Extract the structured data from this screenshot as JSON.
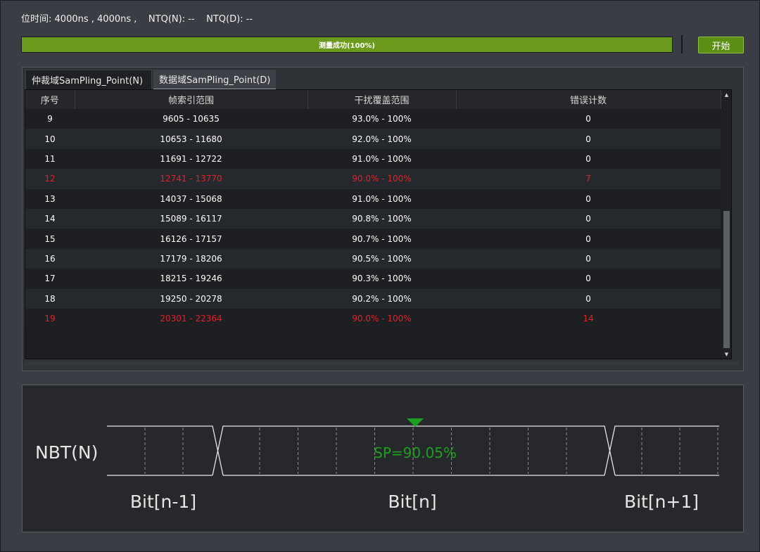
{
  "status": {
    "bit_time_label": "位时间:",
    "bit_time_value": "4000ns , 4000ns ,",
    "ntq_n": "NTQ(N): --",
    "ntq_d": "NTQ(D): --"
  },
  "progress": {
    "label": "测量成功(100%)",
    "value": 100,
    "color": "#6b9a1d"
  },
  "toolbar": {
    "start_label": "开始"
  },
  "tabs": [
    {
      "label": "仲裁域SamPling_Point(N)",
      "active": true
    },
    {
      "label": "数据域SamPling_Point(D)",
      "active": false
    }
  ],
  "table": {
    "columns": [
      "序号",
      "帧索引范围",
      "干扰覆盖范围",
      "错误计数"
    ],
    "rows": [
      {
        "index": "9",
        "frame_range": "9605 - 10635",
        "coverage": "93.0% - 100%",
        "errors": "0",
        "error": false
      },
      {
        "index": "10",
        "frame_range": "10653 - 11680",
        "coverage": "92.0% - 100%",
        "errors": "0",
        "error": false
      },
      {
        "index": "11",
        "frame_range": "11691 - 12722",
        "coverage": "91.0% - 100%",
        "errors": "0",
        "error": false
      },
      {
        "index": "12",
        "frame_range": "12741 - 13770",
        "coverage": "90.0% - 100%",
        "errors": "7",
        "error": true
      },
      {
        "index": "13",
        "frame_range": "14037 - 15068",
        "coverage": "91.0% - 100%",
        "errors": "0",
        "error": false
      },
      {
        "index": "14",
        "frame_range": "15089 - 16117",
        "coverage": "90.8% - 100%",
        "errors": "0",
        "error": false
      },
      {
        "index": "15",
        "frame_range": "16126 - 17157",
        "coverage": "90.7% - 100%",
        "errors": "0",
        "error": false
      },
      {
        "index": "16",
        "frame_range": "17179 - 18206",
        "coverage": "90.5% - 100%",
        "errors": "0",
        "error": false
      },
      {
        "index": "17",
        "frame_range": "18215 - 19246",
        "coverage": "90.3% - 100%",
        "errors": "0",
        "error": false
      },
      {
        "index": "18",
        "frame_range": "19250 - 20278",
        "coverage": "90.2% - 100%",
        "errors": "0",
        "error": false
      },
      {
        "index": "19",
        "frame_range": "20301 - 22364",
        "coverage": "90.0% - 100%",
        "errors": "14",
        "error": true
      }
    ],
    "error_color": "#e0222a"
  },
  "scrollbar": {
    "up_icon": "triangle-up-icon",
    "down_icon": "triangle-down-icon"
  },
  "diagram": {
    "signal_label": "NBT(N)",
    "bit_labels": [
      "Bit[n-1]",
      "Bit[n]",
      "Bit[n+1]"
    ],
    "sample_point_label": "SP=90.05%",
    "sample_point_percent": 90.05,
    "marker_icon": "triangle-down-marker-icon",
    "marker_color": "#1ea01e",
    "line_color": "#e6e6e6"
  }
}
